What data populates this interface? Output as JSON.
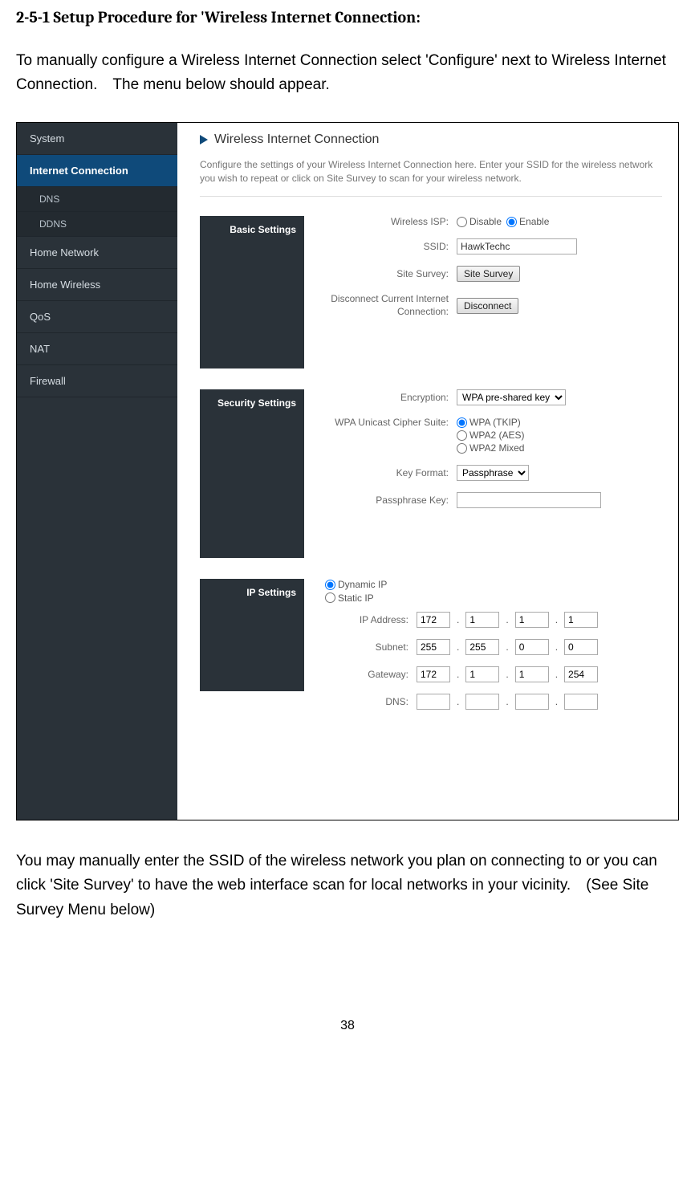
{
  "doc": {
    "section_heading": "2-5-1 Setup Procedure for 'Wireless Internet Connection:",
    "intro": "To manually configure a Wireless Internet Connection select 'Configure' next to Wireless Internet Connection. The menu below should appear.",
    "outro": "You may manually enter the SSID of the wireless network you plan on connecting to or you can click 'Site Survey' to have the web interface scan for local networks in your vicinity. (See Site Survey Menu below)",
    "page_number": "38"
  },
  "screenshot": {
    "page_title": "Wireless Internet Connection",
    "page_desc": "Configure the settings of your Wireless Internet Connection here. Enter your SSID for the wireless network you wish to repeat or click on Site Survey to scan for your wireless network.",
    "sidebar": {
      "items": [
        {
          "label": "System"
        },
        {
          "label": "Internet Connection",
          "active": true,
          "subs": [
            "DNS",
            "DDNS"
          ]
        },
        {
          "label": "Home Network"
        },
        {
          "label": "Home Wireless"
        },
        {
          "label": "QoS"
        },
        {
          "label": "NAT"
        },
        {
          "label": "Firewall"
        }
      ]
    },
    "basic": {
      "heading": "Basic Settings",
      "wireless_isp_label": "Wireless ISP:",
      "disable_label": "Disable",
      "enable_label": "Enable",
      "ssid_label": "SSID:",
      "ssid_value": "HawkTechc",
      "site_survey_label": "Site Survey:",
      "site_survey_btn": "Site Survey",
      "disconnect_label": "Disconnect Current Internet Connection:",
      "disconnect_btn": "Disconnect"
    },
    "security": {
      "heading": "Security Settings",
      "encryption_label": "Encryption:",
      "encryption_value": "WPA pre-shared key",
      "cipher_label": "WPA Unicast Cipher Suite:",
      "cipher_opts": [
        "WPA (TKIP)",
        "WPA2 (AES)",
        "WPA2 Mixed"
      ],
      "key_format_label": "Key Format:",
      "key_format_value": "Passphrase",
      "passphrase_label": "Passphrase Key:"
    },
    "ip": {
      "heading": "IP Settings",
      "dynamic_label": "Dynamic IP",
      "static_label": "Static IP",
      "ip_addr_label": "IP Address:",
      "ip_addr": [
        "172",
        "1",
        "1",
        "1"
      ],
      "subnet_label": "Subnet:",
      "subnet": [
        "255",
        "255",
        "0",
        "0"
      ],
      "gateway_label": "Gateway:",
      "gateway": [
        "172",
        "1",
        "1",
        "254"
      ],
      "dns_label": "DNS:",
      "dns": [
        "",
        "",
        "",
        ""
      ]
    }
  }
}
